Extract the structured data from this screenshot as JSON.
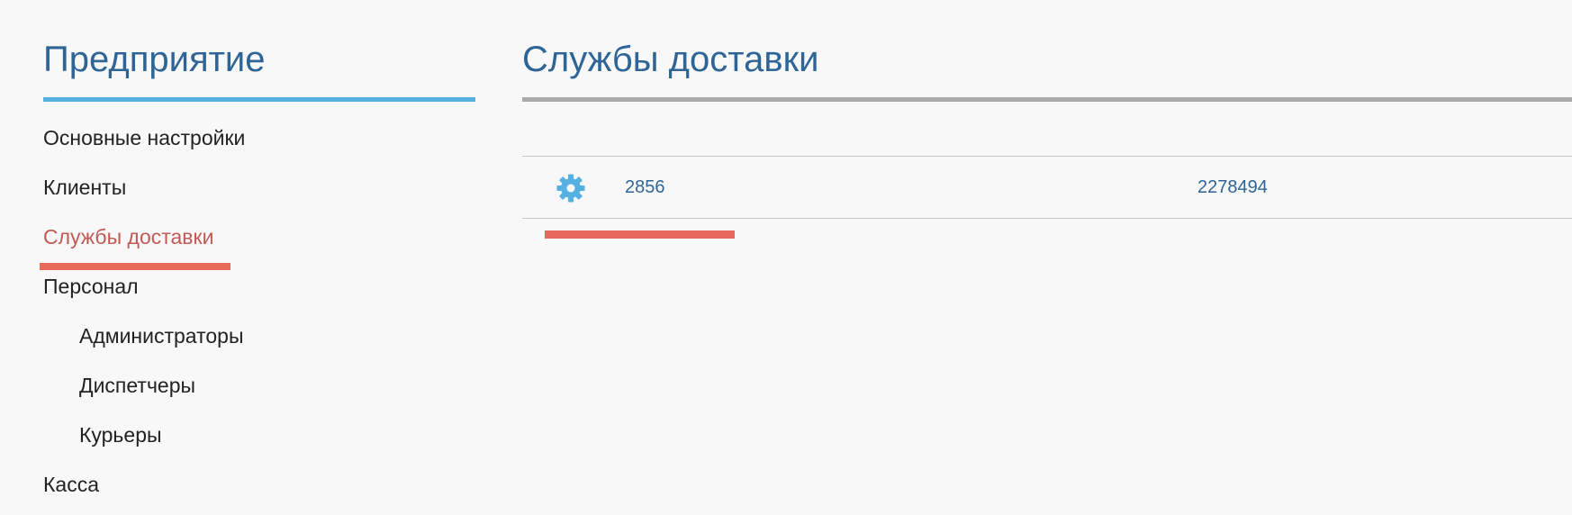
{
  "sidebar": {
    "title": "Предприятие",
    "items": [
      {
        "label": "Основные настройки"
      },
      {
        "label": "Клиенты"
      },
      {
        "label": "Службы доставки"
      },
      {
        "label": "Персонал"
      },
      {
        "label": "Администраторы"
      },
      {
        "label": "Диспетчеры"
      },
      {
        "label": "Курьеры"
      },
      {
        "label": "Касса"
      }
    ],
    "active_item": "Службы доставки"
  },
  "main": {
    "title": "Службы доставки",
    "rows": [
      {
        "icon": "gear-icon",
        "id": "2856",
        "code": "2278494"
      }
    ]
  },
  "colors": {
    "title": "#2f6596",
    "sidebar_rule": "#56b0e2",
    "main_rule": "#aaaaaa",
    "active_item": "#c15a55",
    "highlight": "#e8685b",
    "gear": "#56b0e2",
    "link": "#2f6596"
  }
}
